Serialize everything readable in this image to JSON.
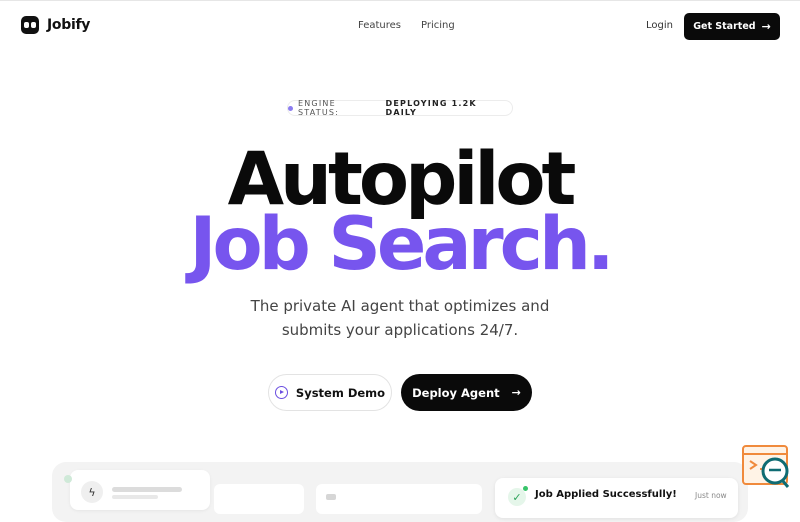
{
  "nav": {
    "brand": "Jobify",
    "links": [
      "Features",
      "Pricing"
    ],
    "login": "Login",
    "cta": "Get Started"
  },
  "status": {
    "label": "ENGINE STATUS:",
    "value": "DEPLOYING 1.2K DAILY"
  },
  "hero": {
    "line1": "Autopilot",
    "line2": "Job Search.",
    "subtitle_line1": "The private AI agent that optimizes and",
    "subtitle_line2": "submits your applications 24/7."
  },
  "cta": {
    "demo": "System Demo",
    "deploy": "Deploy Agent"
  },
  "preview": {
    "notification_title": "Job Applied Successfully!",
    "notification_time": "Just now"
  },
  "colors": {
    "accent": "#7755ee",
    "dark": "#0a0a0a",
    "success": "#38c46a"
  },
  "icons": [
    "logo-icon",
    "arrow-right-icon",
    "play-icon",
    "bolt-icon",
    "check-icon",
    "chat-widget-icon"
  ]
}
